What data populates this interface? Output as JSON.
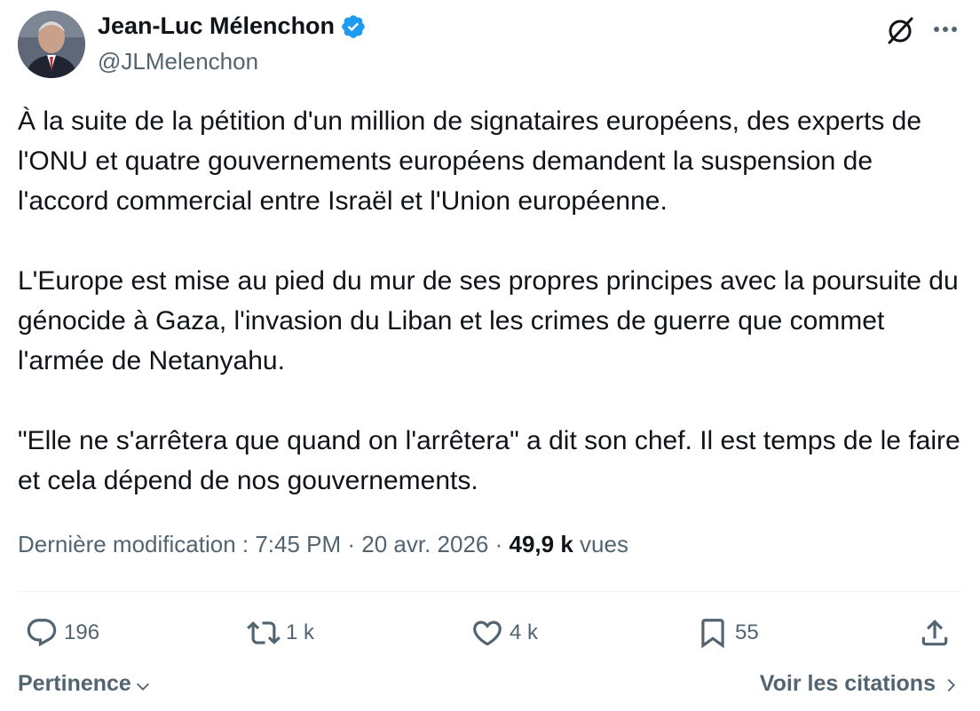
{
  "author": {
    "name": "Jean-Luc Mélenchon",
    "handle": "@JLMelenchon",
    "verified": true,
    "verified_color": "#1d9bf0"
  },
  "tweet": {
    "paragraphs": [
      "À la suite de la pétition d'un million de signataires européens, des experts de l'ONU et quatre gouvernements européens demandent la suspension de l'accord commercial entre Israël et l'Union européenne.",
      "L'Europe est mise au pied du mur de ses propres principes avec la poursuite du génocide à Gaza, l'invasion du Liban et les crimes de guerre que commet l'armée de Netanyahu.",
      "\"Elle ne s'arrêtera que quand on l'arrêtera\" a dit son chef. Il est temps de le faire et cela dépend de nos gouvernements."
    ]
  },
  "meta": {
    "edited_label": "Dernière modification : 7:45 PM · 20 avr. 2026 ·",
    "views_count": "49,9 k",
    "views_label": "vues"
  },
  "actions": {
    "replies": "196",
    "reposts": "1 k",
    "likes": "4 k",
    "bookmarks": "55"
  },
  "icons": {
    "grok": "slashed-circle-icon",
    "more": "more-dots-icon",
    "reply": "speech-bubble-icon",
    "repost": "repost-arrows-icon",
    "like": "heart-icon",
    "bookmark": "bookmark-icon",
    "share": "share-upload-icon"
  },
  "footer": {
    "sort_label": "Pertinence",
    "quotes_label": "Voir les citations"
  },
  "colors": {
    "text_primary": "#0f1419",
    "text_secondary": "#536471",
    "divider": "#eff3f4"
  }
}
